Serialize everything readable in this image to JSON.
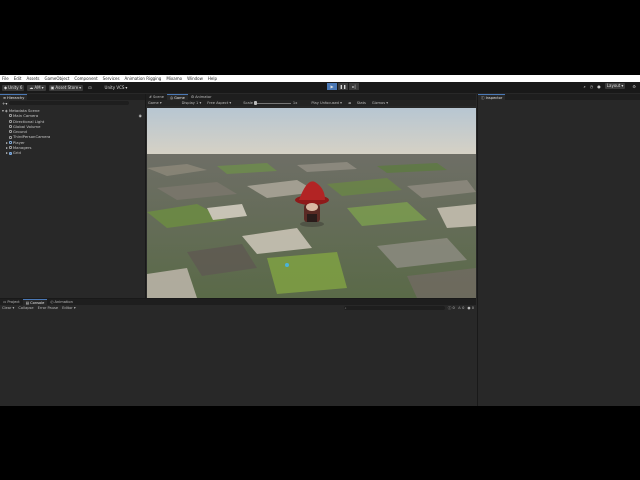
{
  "menu": [
    "File",
    "Edit",
    "Assets",
    "GameObject",
    "Component",
    "Services",
    "Animation Rigging",
    "Mixamo",
    "Window",
    "Help"
  ],
  "toolbar": {
    "account": "Unity 6",
    "user_badge": "AM",
    "asset_store": "Asset Store",
    "vcs": "Unity VCS",
    "layout": "Layout"
  },
  "hierarchy": {
    "tab": "Hierarchy",
    "root": "Metadata Scene",
    "items": [
      "Main Camera",
      "Directional Light",
      "Global Volume",
      "Ground",
      "ThirdPersonCamera",
      "Player",
      "Managers",
      "Grid"
    ]
  },
  "scene": {
    "tabs": [
      "Scene",
      "Game",
      "Animator"
    ],
    "game_toolbar": {
      "mode": "Game",
      "display": "Display 1",
      "aspect": "Free Aspect",
      "scale_label": "Scale",
      "scale_value": "1x",
      "play_mode": "Play Unfocused",
      "stats": "Stats",
      "gizmos": "Gizmos"
    }
  },
  "inspector": {
    "tab": "Inspector"
  },
  "console": {
    "tabs": [
      "Project",
      "Console",
      "Animation"
    ],
    "toolbar": [
      "Clear",
      "Collapse",
      "Error Pause",
      "Editor"
    ],
    "counts": [
      "0",
      "0",
      "0"
    ]
  },
  "colors": {
    "accent": "#4a78b5",
    "panel": "#282828",
    "dark": "#191919"
  }
}
